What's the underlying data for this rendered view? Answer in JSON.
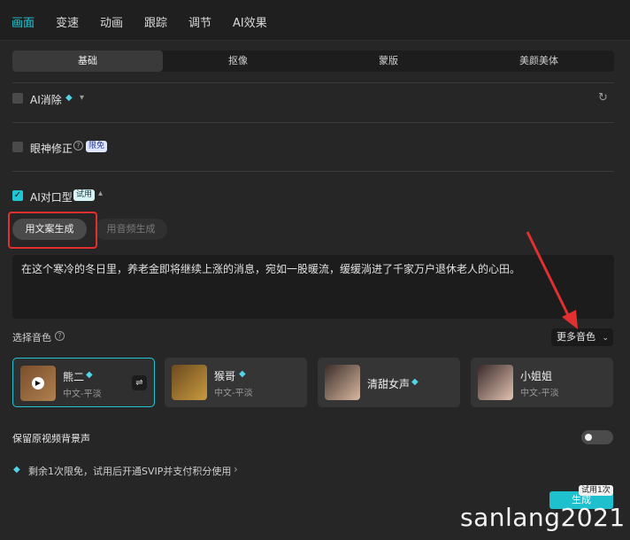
{
  "top_tabs": [
    "画面",
    "变速",
    "动画",
    "跟踪",
    "调节",
    "AI效果"
  ],
  "sub_tabs": [
    "基础",
    "抠像",
    "蒙版",
    "美颜美体"
  ],
  "ai_remove": {
    "label": "AI消除"
  },
  "eye_fix": {
    "label": "眼神修正",
    "badge": "限免"
  },
  "lip_sync": {
    "label": "AI对口型",
    "badge": "试用",
    "mode_text_btn": "用文案生成",
    "mode_audio_btn": "用音频生成",
    "script": "在这个寒冷的冬日里，养老金即将继续上涨的消息，宛如一股暖流，缓缓淌进了千家万户退休老人的心田。"
  },
  "voice": {
    "select_label": "选择音色",
    "more_button": "更多音色",
    "cards": [
      {
        "name": "熊二",
        "sub": "中文-平淡"
      },
      {
        "name": "猴哥",
        "sub": "中文-平淡"
      },
      {
        "name": "清甜女声",
        "sub": ""
      },
      {
        "name": "小姐姐",
        "sub": "中文-平淡"
      }
    ]
  },
  "keep_bg": {
    "label": "保留原视频背景声"
  },
  "notice": "剩余1次限免，试用后开通SVIP并支付积分使用",
  "generate": {
    "label": "生成",
    "trial_tag": "试用1次"
  },
  "watermark": "sanlang2021",
  "colors": {
    "accent": "#22c5d3",
    "annotation": "#e23030"
  }
}
